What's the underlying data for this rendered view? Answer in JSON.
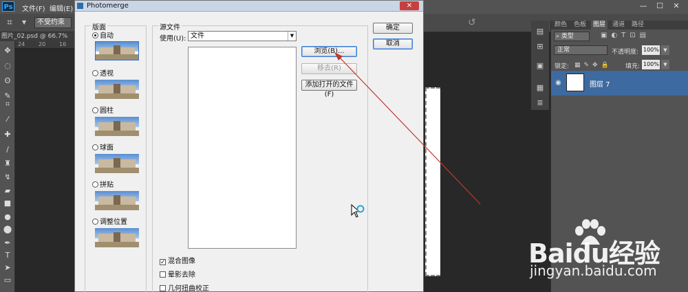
{
  "app": {
    "logo": "Ps",
    "menu": [
      "文件(F)",
      "编辑(E)"
    ],
    "window_buttons": [
      "—",
      "☐",
      "✕"
    ]
  },
  "options_bar": {
    "constraint_select": "不受约束"
  },
  "document": {
    "tab_label": "图片_02.psd @ 66.7%",
    "ruler_labels": [
      "24",
      "20",
      "16"
    ]
  },
  "dialog": {
    "title": "Photomerge",
    "layout_group": "版面",
    "layouts": [
      {
        "label": "自动",
        "selected": true
      },
      {
        "label": "透视",
        "selected": false
      },
      {
        "label": "圆柱",
        "selected": false
      },
      {
        "label": "球面",
        "selected": false
      },
      {
        "label": "拼贴",
        "selected": false
      },
      {
        "label": "调整位置",
        "selected": false
      }
    ],
    "source_group": "源文件",
    "use_label": "使用(U):",
    "use_value": "文件",
    "browse_button": "浏览(B)...",
    "remove_button": "移去(R)",
    "add_open_button": "添加打开的文件(F)",
    "ok_button": "确定",
    "cancel_button": "取消",
    "checkboxes": [
      {
        "label": "混合图像",
        "checked": true
      },
      {
        "label": "晕影去除",
        "checked": false
      },
      {
        "label": "几何扭曲校正",
        "checked": false
      }
    ]
  },
  "layers_panel": {
    "tabs": [
      "颜色",
      "色板",
      "图层",
      "通道",
      "路径"
    ],
    "active_tab": "图层",
    "filter": "类型",
    "blend_mode": "正常",
    "opacity_label": "不透明度:",
    "opacity": "100%",
    "lock_label": "锁定:",
    "fill_label": "填充:",
    "fill": "100%",
    "layer_name": "图层 7"
  },
  "colors": {
    "ps_dark": "#282828",
    "dialog_bg": "#f0f0f0",
    "annotation_red": "#c0392b",
    "selected_layer": "#3d6aa0"
  },
  "watermark": {
    "brand": "Baidu经验",
    "url": "jingyan.baidu.com"
  }
}
